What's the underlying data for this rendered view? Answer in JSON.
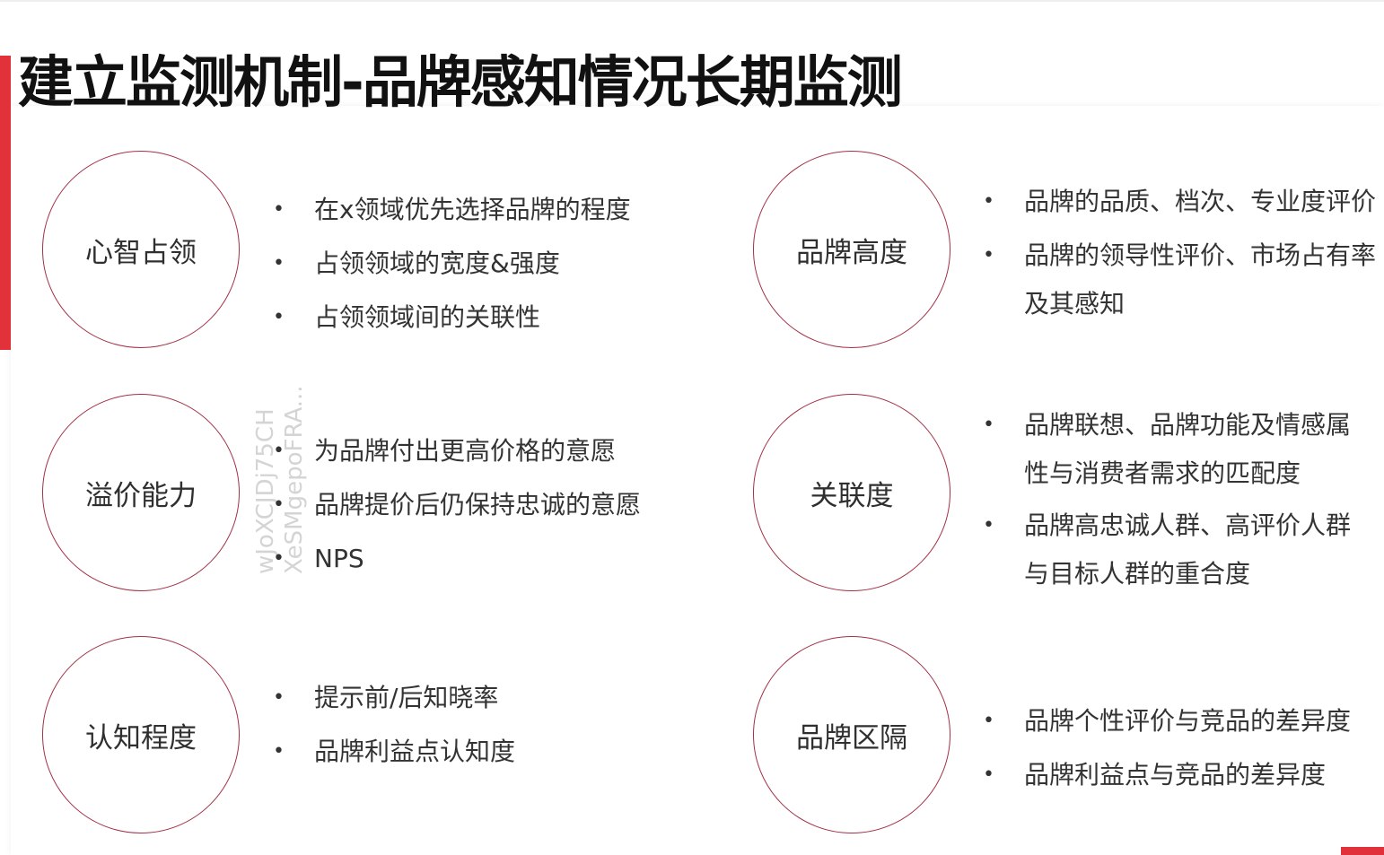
{
  "title": "建立监测机制-品牌感知情况长期监测",
  "watermark": {
    "line1": "wJoXCJDj75CH",
    "line2": "XeSMgepoFRA..."
  },
  "left_sections": [
    {
      "circle": "心智占领",
      "bullets": [
        "在x领域优先选择品牌的程度",
        "占领领域的宽度&强度",
        "占领领域间的关联性"
      ]
    },
    {
      "circle": "溢价能力",
      "bullets": [
        "为品牌付出更高价格的意愿",
        "品牌提价后仍保持忠诚的意愿",
        "NPS"
      ]
    },
    {
      "circle": "认知程度",
      "bullets": [
        "提示前/后知晓率",
        "品牌利益点认知度"
      ]
    }
  ],
  "right_sections": [
    {
      "circle": "品牌高度",
      "bullets": [
        {
          "line1": "品牌的品质、档次、专业度评价",
          "line2": ""
        },
        {
          "line1": "品牌的领导性评价、市场占有率",
          "line2": "及其感知"
        }
      ]
    },
    {
      "circle": "关联度",
      "bullets": [
        {
          "line1": "品牌联想、品牌功能及情感属",
          "line2": "性与消费者需求的匹配度"
        },
        {
          "line1": "品牌高忠诚人群、高评价人群",
          "line2": "与目标人群的重合度"
        }
      ]
    },
    {
      "circle": "品牌区隔",
      "bullets": [
        {
          "line1": "品牌个性评价与竞品的差异度",
          "line2": ""
        },
        {
          "line1": "品牌利益点与竞品的差异度",
          "line2": ""
        }
      ]
    }
  ],
  "bullet_char": "•",
  "colors": {
    "accent_red": "#e1313a",
    "circle_border": "#a33045"
  }
}
